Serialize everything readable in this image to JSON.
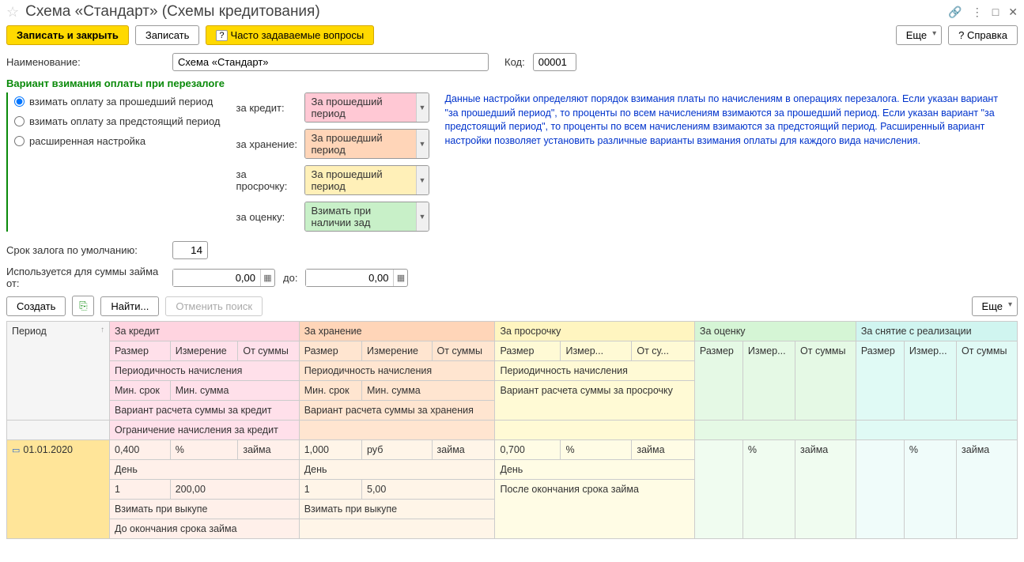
{
  "header": {
    "title": "Схема «Стандарт» (Схемы кредитования)"
  },
  "toolbar": {
    "save_close": "Записать и закрыть",
    "save": "Записать",
    "faq": "Часто задаваемые вопросы",
    "more": "Еще",
    "help": "Справка"
  },
  "form": {
    "name_label": "Наименование:",
    "name_value": "Схема «Стандарт»",
    "code_label": "Код:",
    "code_value": "00001"
  },
  "variant": {
    "section_title": "Вариант взимания оплаты при перезалоге",
    "radios": {
      "past": "взимать оплату за прошедший период",
      "future": "взимать оплату за предстоящий период",
      "extended": "расширенная настройка"
    },
    "settings": {
      "credit_label": "за кредит:",
      "credit_value": "За прошедший период",
      "storage_label": "за хранение:",
      "storage_value": "За прошедший период",
      "overdue_label": "за просрочку:",
      "overdue_value": "За прошедший период",
      "eval_label": "за оценку:",
      "eval_value": "Взимать при наличии зад"
    },
    "info": "Данные настройки определяют порядок взимания платы по начислениям в операциях перезалога.  Если указан вариант \"за прошедший период\", то проценты по всем начислениям взимаются за прошедший период. Если указан вариант \"за предстоящий период\", то проценты по всем начислениям взимаются за предстоящий период. Расширенный вариант настройки позволяет установить различные варианты взимания оплаты для каждого вида начисления."
  },
  "defaults": {
    "term_label": "Срок залога по умолчанию:",
    "term_value": "14",
    "sum_from_label": "Используется для суммы займа от:",
    "sum_from_value": "0,00",
    "sum_to_label": "до:",
    "sum_to_value": "0,00"
  },
  "table_toolbar": {
    "create": "Создать",
    "find": "Найти...",
    "cancel": "Отменить поиск",
    "more": "Еще"
  },
  "table": {
    "headers": {
      "period": "Период",
      "credit": "За кредит",
      "storage": "За хранение",
      "overdue": "За просрочку",
      "eval": "За оценку",
      "release": "За снятие с реализации",
      "size": "Размер",
      "measure": "Измерение",
      "measure_short": "Измер...",
      "from_sum": "От суммы",
      "from_sum_short": "От су...",
      "periodicity": "Периодичность начисления",
      "min_term": "Мин. срок",
      "min_sum": "Мин. сумма",
      "credit_calc": "Вариант расчета суммы за кредит",
      "storage_calc": "Вариант расчета суммы за хранения",
      "overdue_calc": "Вариант расчета суммы за просрочку",
      "credit_limit": "Ограничение начисления за кредит"
    },
    "row": {
      "period": "01.01.2020",
      "credit_size": "0,400",
      "credit_measure": "%",
      "credit_from": "займа",
      "storage_size": "1,000",
      "storage_measure": "руб",
      "storage_from": "займа",
      "overdue_size": "0,700",
      "overdue_measure": "%",
      "overdue_from": "займа",
      "eval_size": "",
      "eval_measure": "%",
      "eval_from": "займа",
      "release_size": "",
      "release_measure": "%",
      "release_from": "займа",
      "day": "День",
      "credit_min_term": "1",
      "credit_min_sum": "200,00",
      "storage_min_term": "1",
      "storage_min_sum": "5,00",
      "overdue_variant": "После окончания срока займа",
      "on_buyout": "Взимать при выкупе",
      "until_end": "До окончания срока займа"
    }
  }
}
